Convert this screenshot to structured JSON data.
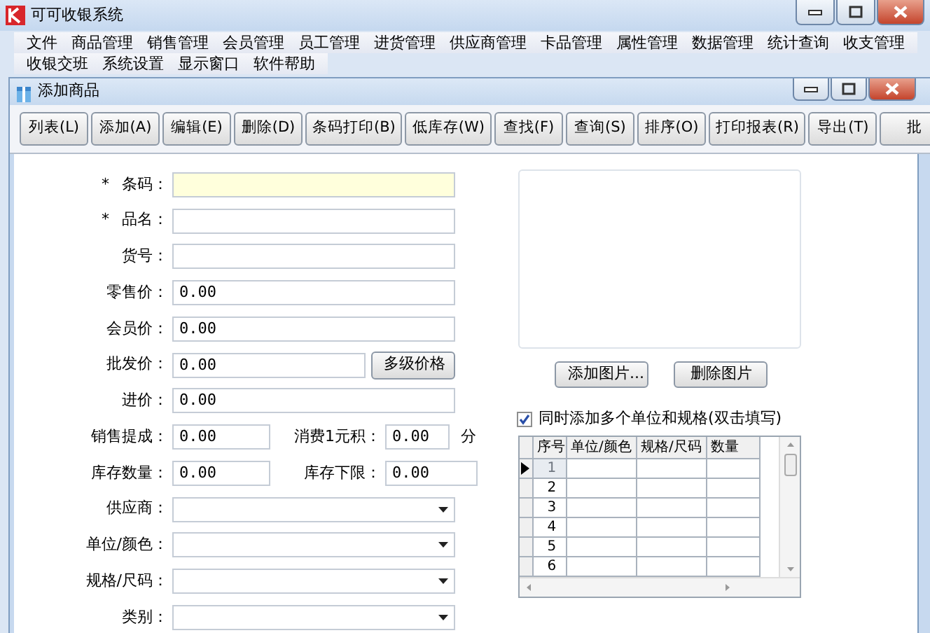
{
  "window": {
    "title": "可可收银系统"
  },
  "menu": [
    [
      "文件",
      "商品管理",
      "销售管理",
      "会员管理",
      "员工管理",
      "进货管理",
      "供应商管理",
      "卡品管理",
      "属性管理",
      "数据管理",
      "统计查询",
      "收支管理"
    ],
    [
      "收银交班",
      "系统设置",
      "显示窗口",
      "软件帮助"
    ]
  ],
  "child_window": {
    "title": "添加商品"
  },
  "toolbar": [
    "列表(L)",
    "添加(A)",
    "编辑(E)",
    "删除(D)",
    "条码打印(B)",
    "低库存(W)",
    "查找(F)",
    "查询(S)",
    "排序(O)",
    "打印报表(R)",
    "导出(T)",
    "批"
  ],
  "form": [
    {
      "kind": "text",
      "required_mark": "*",
      "label": "条码：",
      "highlighted": true
    },
    {
      "kind": "text",
      "required_mark": "*",
      "label": "品名：",
      "highlighted": false
    },
    {
      "kind": "text",
      "label": "货号：",
      "highlighted": false
    },
    {
      "kind": "text",
      "label": "零售价：",
      "value": "0.00",
      "highlighted": false
    },
    {
      "kind": "text",
      "label": "会员价：",
      "value": "0.00",
      "highlighted": false
    },
    {
      "kind": "button",
      "label": "批发价：",
      "value": "0.00",
      "button": "多级价格"
    },
    {
      "kind": "text",
      "label": "进价：",
      "value": "0.00",
      "highlighted": false
    },
    {
      "kind": "pair",
      "items": [
        {
          "label": "销售提成：",
          "value": "0.00"
        },
        {
          "label": "消费1元积：",
          "value": "0.00",
          "suffix": "分"
        }
      ]
    },
    {
      "kind": "pair",
      "items": [
        {
          "label": "库存数量：",
          "value": "0.00"
        },
        {
          "label": "库存下限：",
          "value": "0.00"
        }
      ]
    },
    {
      "kind": "select",
      "label": "供应商："
    },
    {
      "kind": "select",
      "label": "单位/颜色："
    },
    {
      "kind": "select",
      "label": "规格/尺码："
    },
    {
      "kind": "select",
      "label": "类别："
    }
  ],
  "image_buttons": [
    "添加图片...",
    "删除图片"
  ],
  "multi_option": {
    "label": "同时添加多个单位和规格(双击填写)",
    "checked": true
  },
  "grid": {
    "columns": [
      "序号",
      "单位/颜色",
      "规格/尺码",
      "数量"
    ],
    "rows": [
      {
        "number": "1",
        "selected": true
      },
      {
        "number": "2",
        "selected": false
      },
      {
        "number": "3",
        "selected": false
      },
      {
        "number": "4",
        "selected": false
      },
      {
        "number": "5",
        "selected": false
      },
      {
        "number": "6",
        "selected": false
      }
    ]
  }
}
